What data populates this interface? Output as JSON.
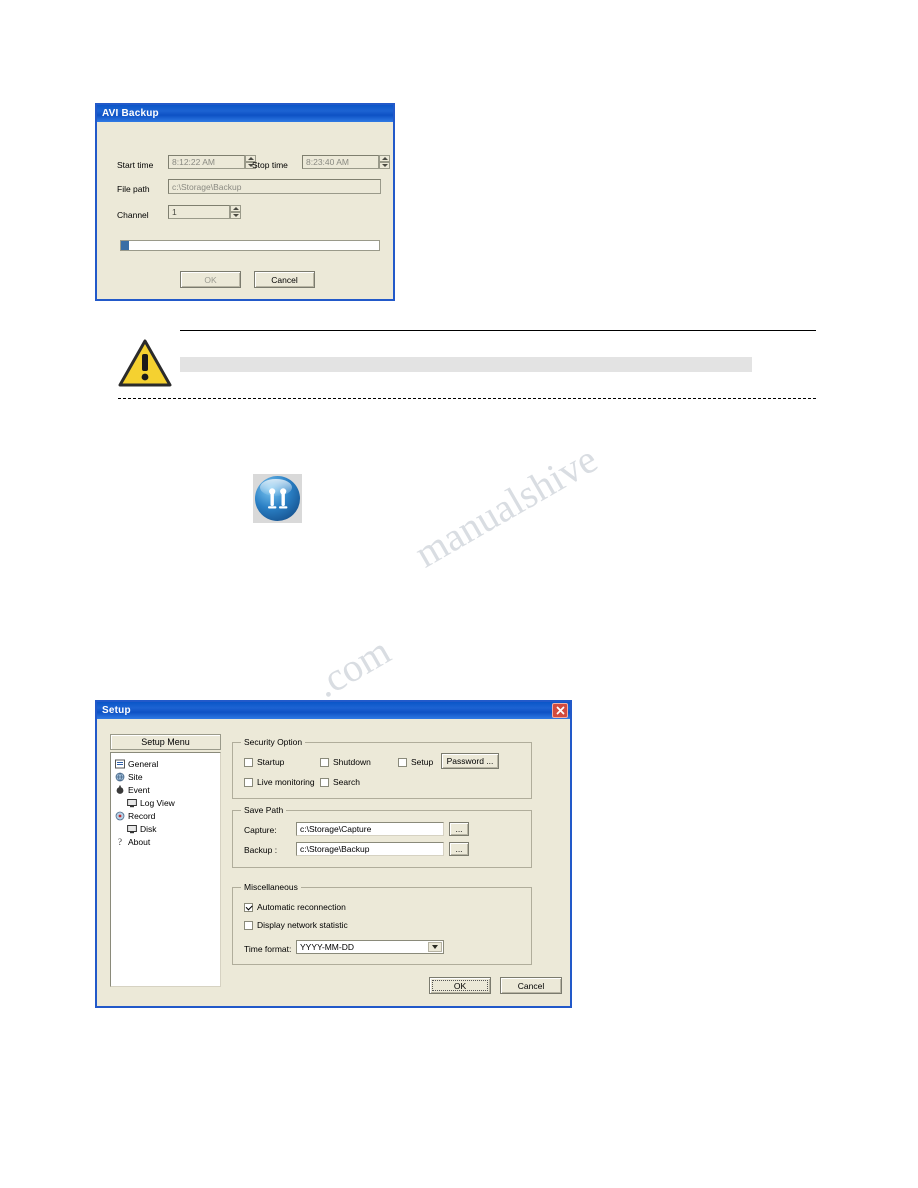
{
  "avi_backup": {
    "title": "AVI Backup",
    "labels": {
      "start_time": "Start time",
      "stop_time": "Stop time",
      "file_path": "File path",
      "channel": "Channel"
    },
    "values": {
      "start_time": "8:12:22 AM",
      "stop_time": "8:23:40 AM",
      "file_path": "c:\\Storage\\Backup",
      "channel": "1"
    },
    "progress_percent": 2,
    "buttons": {
      "ok": "OK",
      "cancel": "Cancel"
    }
  },
  "setup": {
    "title": "Setup",
    "menu_header": "Setup Menu",
    "tree": [
      {
        "label": "General",
        "icon": "general-icon",
        "indent": 0
      },
      {
        "label": "Site",
        "icon": "site-icon",
        "indent": 0
      },
      {
        "label": "Event",
        "icon": "event-icon",
        "indent": 0
      },
      {
        "label": "Log View",
        "icon": "logview-icon",
        "indent": 1
      },
      {
        "label": "Record",
        "icon": "record-icon",
        "indent": 0
      },
      {
        "label": "Disk",
        "icon": "disk-icon",
        "indent": 1
      },
      {
        "label": "About",
        "icon": "about-icon",
        "indent": 0
      }
    ],
    "security_option": {
      "title": "Security Option",
      "checkboxes": [
        {
          "label": "Startup",
          "checked": false
        },
        {
          "label": "Shutdown",
          "checked": false
        },
        {
          "label": "Setup",
          "checked": false
        },
        {
          "label": "Live monitoring",
          "checked": false
        },
        {
          "label": "Search",
          "checked": false
        }
      ],
      "password_button": "Password ..."
    },
    "save_path": {
      "title": "Save Path",
      "rows": [
        {
          "label": "Capture:",
          "value": "c:\\Storage\\Capture",
          "browse": "..."
        },
        {
          "label": "Backup :",
          "value": "c:\\Storage\\Backup",
          "browse": "..."
        }
      ]
    },
    "miscellaneous": {
      "title": "Miscellaneous",
      "checkboxes": [
        {
          "label": "Automatic reconnection",
          "checked": true
        },
        {
          "label": "Display network statistic",
          "checked": false
        }
      ],
      "time_format_label": "Time format:",
      "time_format_value": "YYYY-MM-DD"
    },
    "buttons": {
      "ok": "OK",
      "cancel": "Cancel"
    }
  },
  "toolbar": {
    "setup_icon": "setup-tool-icon"
  },
  "watermark": {
    "line1": "manualshive",
    "line2": ".com"
  },
  "colors": {
    "title_blue": "#0a56c8",
    "dialog_face": "#ece9d8",
    "progress": "#3a6ea5",
    "close_red": "#d24b3e"
  }
}
